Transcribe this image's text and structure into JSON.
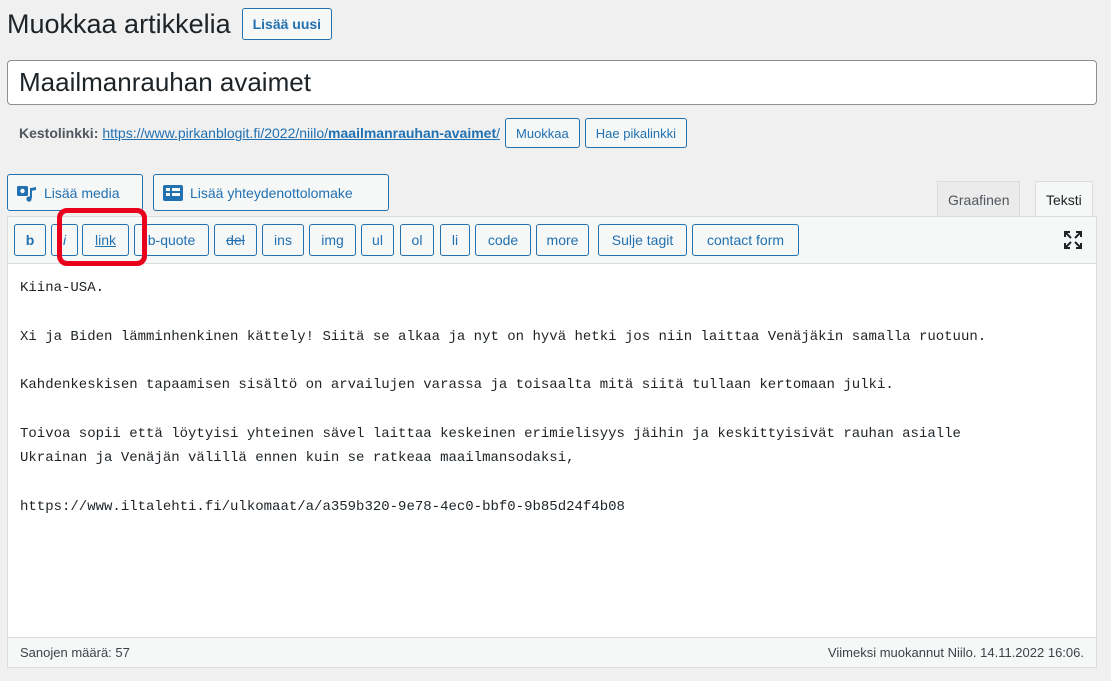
{
  "header": {
    "title": "Muokkaa artikkelia",
    "add_new": "Lisää uusi"
  },
  "post": {
    "title": "Maailmanrauhan avaimet"
  },
  "permalink": {
    "label": "Kestolinkki:",
    "url_base": "https://www.pirkanblogit.fi/2022/niilo/",
    "slug": "maailmanrauhan-avaimet",
    "trailing": "/",
    "edit_label": "Muokkaa",
    "shortlink_label": "Hae pikalinkki"
  },
  "media": {
    "add_media": "Lisää media",
    "add_contact_form": "Lisää yhteydenottolomake"
  },
  "tabs": {
    "visual": "Graafinen",
    "text": "Teksti"
  },
  "quicktags": {
    "b": "b",
    "i": "i",
    "link": "link",
    "bquote": "b-quote",
    "del": "del",
    "ins": "ins",
    "img": "img",
    "ul": "ul",
    "ol": "ol",
    "li": "li",
    "code": "code",
    "more": "more",
    "close_tags": "Sulje tagit",
    "contact_form": "contact form"
  },
  "content": "Kiina-USA.\n\nXi ja Biden lämminhenkinen kättely! Siitä se alkaa ja nyt on hyvä hetki jos niin laittaa Venäjäkin samalla ruotuun.\n\nKahdenkeskisen tapaamisen sisältö on arvailujen varassa ja toisaalta mitä siitä tullaan kertomaan julki.\n\nToivoa sopii että löytyisi yhteinen sävel laittaa keskeinen erimielisyys jäihin ja keskittyisivät rauhan asialle\nUkrainan ja Venäjän välillä ennen kuin se ratkeaa maailmansodaksi,\n\nhttps://www.iltalehti.fi/ulkomaat/a/a359b320-9e78-4ec0-bbf0-9b85d24f4b08",
  "status": {
    "word_count": "Sanojen määrä: 57",
    "last_edited": "Viimeksi muokannut Niilo. 14.11.2022 16:06."
  },
  "colors": {
    "accent": "#2271b1",
    "highlight": "#e8001c"
  }
}
